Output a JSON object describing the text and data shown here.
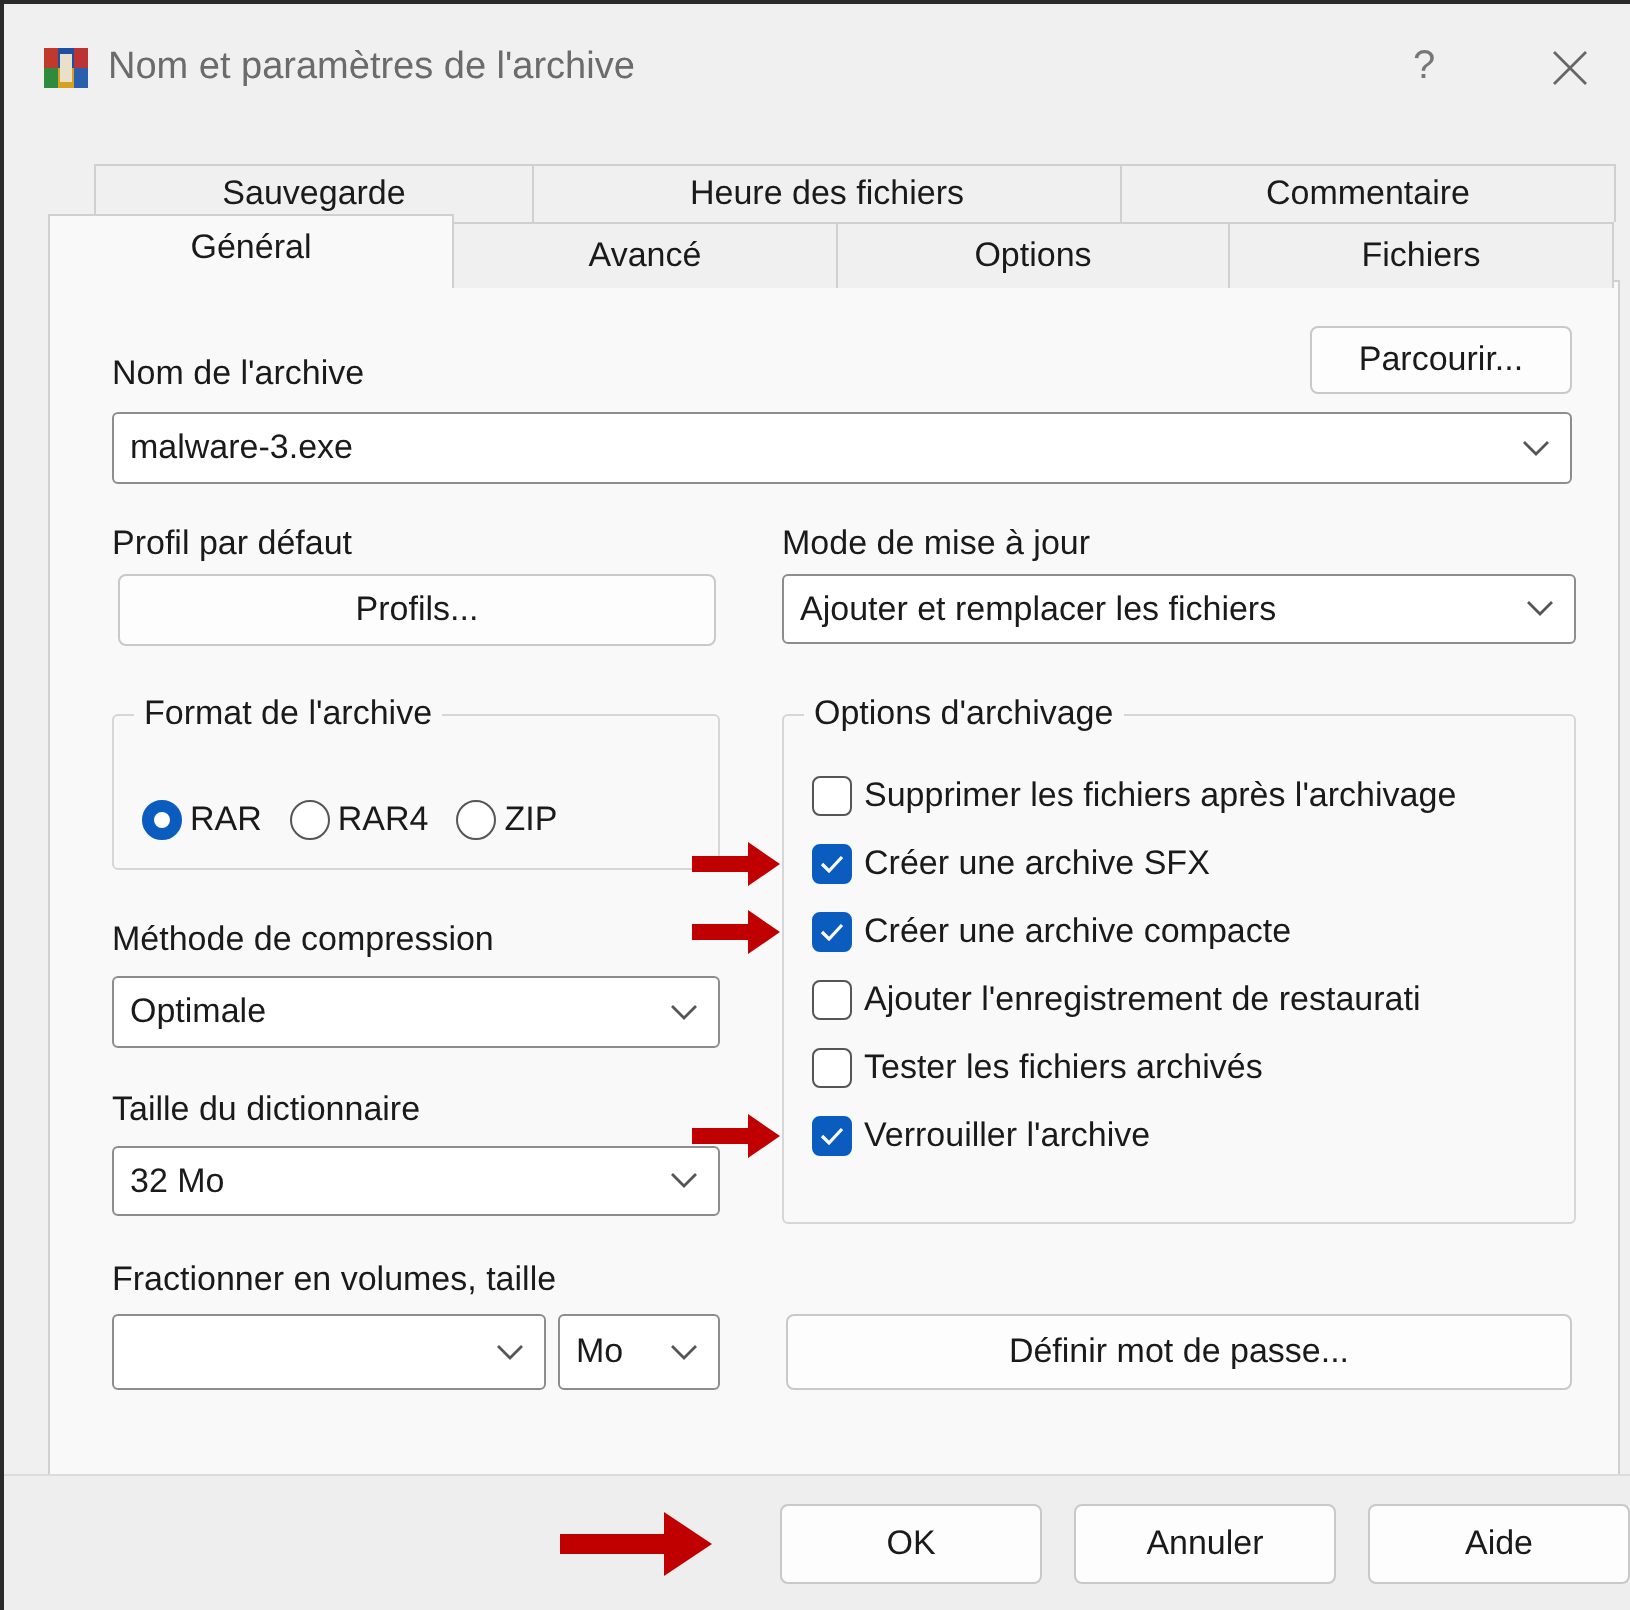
{
  "window": {
    "title": "Nom et paramètres de l'archive",
    "help_button": "?"
  },
  "tab_rows": [
    {
      "tabs": [
        {
          "label": "Sauvegarde",
          "selected": false
        },
        {
          "label": "Heure des fichiers",
          "selected": false
        },
        {
          "label": "Commentaire",
          "selected": false
        }
      ]
    },
    {
      "tabs": [
        {
          "label": "Général",
          "selected": true
        },
        {
          "label": "Avancé",
          "selected": false
        },
        {
          "label": "Options",
          "selected": false
        },
        {
          "label": "Fichiers",
          "selected": false
        }
      ]
    }
  ],
  "general": {
    "archive_name": {
      "label": "Nom de l'archive",
      "value": "malware-3.exe",
      "browse_button": "Parcourir..."
    },
    "default_profile": {
      "label": "Profil par défaut",
      "button": "Profils..."
    },
    "update_mode": {
      "label": "Mode de mise à jour",
      "value": "Ajouter et remplacer les fichiers"
    },
    "archive_format": {
      "label": "Format de l'archive",
      "options": [
        {
          "label": "RAR",
          "selected": true
        },
        {
          "label": "RAR4",
          "selected": false
        },
        {
          "label": "ZIP",
          "selected": false
        }
      ]
    },
    "compression_method": {
      "label": "Méthode de compression",
      "value": "Optimale"
    },
    "dictionary_size": {
      "label": "Taille du dictionnaire",
      "value": "32 Mo"
    },
    "split_volumes": {
      "label": "Fractionner en volumes, taille",
      "unit": "Mo"
    },
    "archive_options": {
      "label": "Options d'archivage",
      "items": [
        {
          "label": "Supprimer les fichiers après l'archivage",
          "checked": false,
          "arrow": false
        },
        {
          "label": "Créer une archive SFX",
          "checked": true,
          "arrow": true
        },
        {
          "label": "Créer une archive compacte",
          "checked": true,
          "arrow": true
        },
        {
          "label": "Ajouter l'enregistrement de restaurati",
          "checked": false,
          "arrow": false
        },
        {
          "label": "Tester les fichiers archivés",
          "checked": false,
          "arrow": false
        },
        {
          "label": "Verrouiller l'archive",
          "checked": true,
          "arrow": true
        }
      ]
    },
    "password_button": "Définir mot de passe..."
  },
  "buttons": [
    {
      "label": "OK",
      "arrow": true
    },
    {
      "label": "Annuler",
      "arrow": false
    },
    {
      "label": "Aide",
      "arrow": false
    }
  ]
}
